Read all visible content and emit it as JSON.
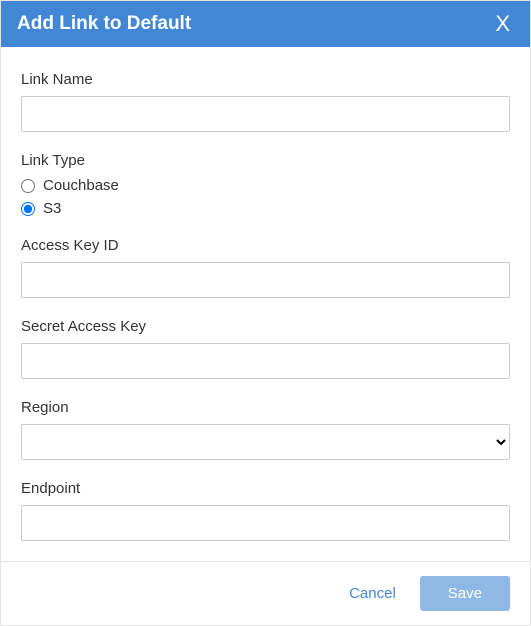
{
  "header": {
    "title": "Add Link to Default",
    "close_label": "X"
  },
  "form": {
    "link_name": {
      "label": "Link Name",
      "value": ""
    },
    "link_type": {
      "label": "Link Type",
      "options": [
        {
          "label": "Couchbase",
          "value": "couchbase",
          "selected": false
        },
        {
          "label": "S3",
          "value": "s3",
          "selected": true
        }
      ]
    },
    "access_key_id": {
      "label": "Access Key ID",
      "value": ""
    },
    "secret_access_key": {
      "label": "Secret Access Key",
      "value": ""
    },
    "region": {
      "label": "Region",
      "value": ""
    },
    "endpoint": {
      "label": "Endpoint",
      "value": ""
    }
  },
  "footer": {
    "cancel_label": "Cancel",
    "save_label": "Save"
  }
}
